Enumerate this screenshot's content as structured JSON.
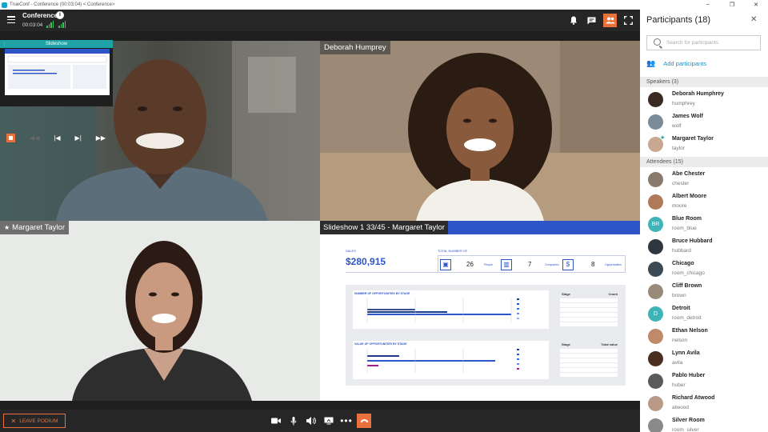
{
  "window": {
    "title": "TrueConf - Conference (00:03:04) < Conference>",
    "minimize": "–",
    "maximize": "❐",
    "close": "✕"
  },
  "topbar": {
    "title": "Conference",
    "timer": "00:03:04",
    "info_icon": "i"
  },
  "videos": {
    "top_right_name": "Deborah Humprey",
    "bottom_left_name": "Margaret Taylor",
    "slideshow_caption": "Slideshow 1 33/45 - Margaret Taylor"
  },
  "mini_slideshow": {
    "title": "Slideshow"
  },
  "slide": {
    "sales_label": "SALES",
    "sales_value": "$280,915",
    "total_label": "TOTAL NUMBER OF",
    "kpi1_value": "26",
    "kpi1_label": "People",
    "kpi2_value": "7",
    "kpi2_label": "Companies",
    "kpi3_value": "8",
    "kpi3_label": "Opportunities",
    "chart1_title": "NUMBER OF OPPORTUNITIES BY STAGE",
    "chart2_title": "VALUE OF OPPORTUNITIES BY STAGE",
    "table1_h1": "Stage",
    "table1_h2": "Count",
    "table2_h1": "Stage",
    "table2_h2": "Total value"
  },
  "bottombar": {
    "leave_label": "LEAVE PODIUM"
  },
  "panel": {
    "title": "Participants (18)",
    "search_placeholder": "Search for participants",
    "add_label": "Add participants",
    "speakers_header": "Speakers (3)",
    "attendees_header": "Attendees (15)",
    "speakers": [
      {
        "name": "Deborah Humphrey",
        "login": "humphrey"
      },
      {
        "name": "James Wolf",
        "login": "wolf"
      },
      {
        "name": "Margaret Taylor",
        "login": "taylor"
      }
    ],
    "attendees": [
      {
        "name": "Abe Chester",
        "login": "chester"
      },
      {
        "name": "Albert Moore",
        "login": "moore"
      },
      {
        "name": "Blue Room",
        "login": "room_blue",
        "initials": "BR"
      },
      {
        "name": "Bruce Hubbard",
        "login": "hubbard"
      },
      {
        "name": "Chicago",
        "login": "room_chicago"
      },
      {
        "name": "Cliff Brown",
        "login": "brown"
      },
      {
        "name": "Detroit",
        "login": "room_detroit",
        "initials": "D"
      },
      {
        "name": "Ethan Nelson",
        "login": "nelson"
      },
      {
        "name": "Lynn Avila",
        "login": "avila"
      },
      {
        "name": "Pablo Huber",
        "login": "huber"
      },
      {
        "name": "Richard Atwood",
        "login": "atwood"
      },
      {
        "name": "Silver Room",
        "login": "room_silver"
      }
    ]
  },
  "colors": {
    "accent": "#e8713c",
    "teal": "#1fa2a6",
    "link": "#1b8fbf",
    "slide_blue": "#2e55c7"
  }
}
